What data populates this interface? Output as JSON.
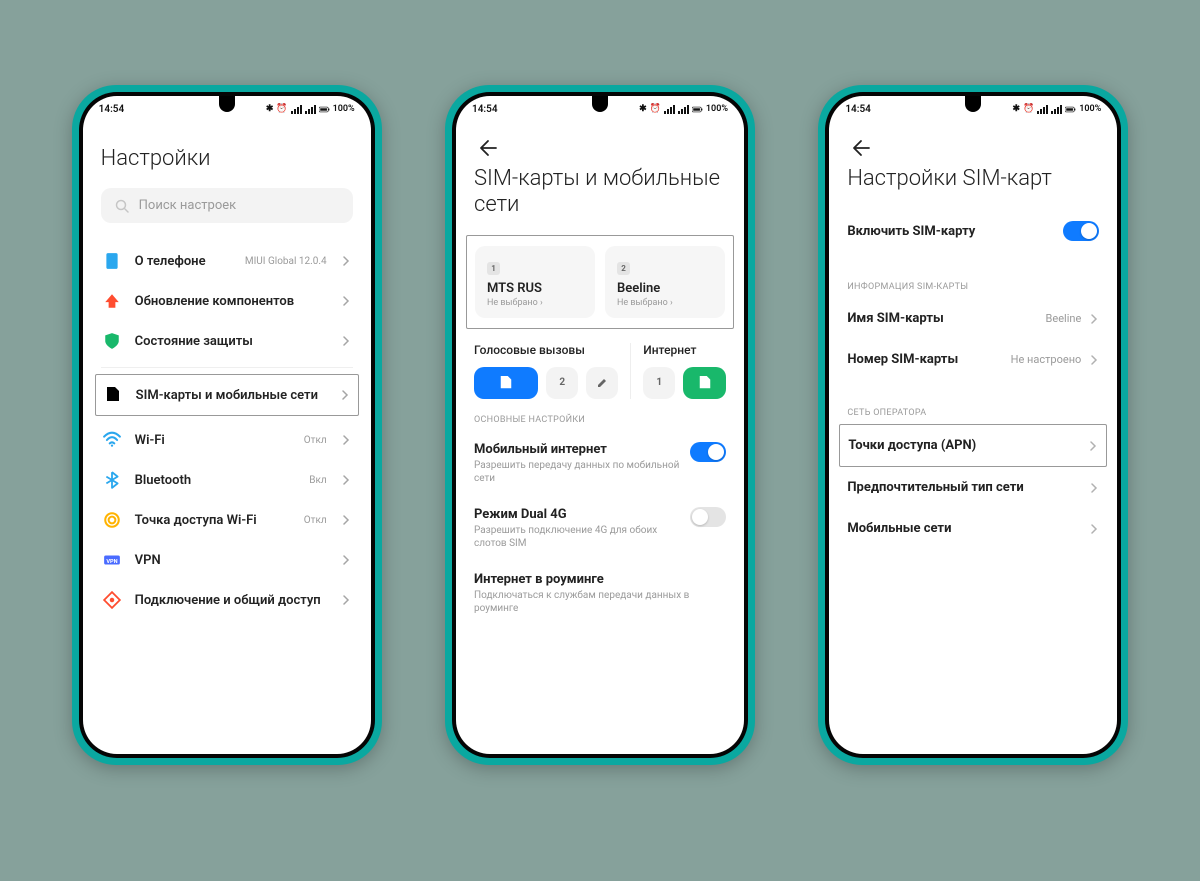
{
  "status": {
    "time": "14:54",
    "battery": "100%"
  },
  "screen1": {
    "title": "Настройки",
    "search_placeholder": "Поиск настроек",
    "items": {
      "about": {
        "label": "О телефоне",
        "value": "MIUI Global 12.0.4"
      },
      "update": {
        "label": "Обновление компонентов"
      },
      "security": {
        "label": "Состояние защиты"
      },
      "sim": {
        "label": "SIM-карты и мобильные сети"
      },
      "wifi": {
        "label": "Wi-Fi",
        "value": "Откл"
      },
      "bt": {
        "label": "Bluetooth",
        "value": "Вкл"
      },
      "hotspot": {
        "label": "Точка доступа Wi-Fi",
        "value": "Откл"
      },
      "vpn": {
        "label": "VPN"
      },
      "share": {
        "label": "Подключение и общий доступ"
      }
    }
  },
  "screen2": {
    "title": "SIM-карты и мобильные сети",
    "sim1": {
      "num": "1",
      "name": "MTS RUS",
      "sub": "Не выбрано"
    },
    "sim2": {
      "num": "2",
      "name": "Beeline",
      "sub": "Не выбрано"
    },
    "voice_label": "Голосовые вызовы",
    "internet_label": "Интернет",
    "chip1": "1",
    "chip2": "2",
    "section_main": "ОСНОВНЫЕ НАСТРОЙКИ",
    "mobile_data": {
      "title": "Мобильный интернет",
      "sub": "Разрешить передачу данных по мобильной сети"
    },
    "dual4g": {
      "title": "Режим Dual 4G",
      "sub": "Разрешить подключение 4G для обоих слотов SIM"
    },
    "roaming": {
      "title": "Интернет в роуминге",
      "sub": "Подключаться к службам передачи данных в роуминге"
    }
  },
  "screen3": {
    "title": "Настройки SIM-карт",
    "enable": "Включить SIM-карту",
    "section_info": "ИНФОРМАЦИЯ SIM-КАРТЫ",
    "sim_name": {
      "label": "Имя SIM-карты",
      "value": "Beeline"
    },
    "sim_number": {
      "label": "Номер SIM-карты",
      "value": "Не настроено"
    },
    "section_net": "СЕТЬ ОПЕРАТОРА",
    "apn": "Точки доступа (APN)",
    "net_type": "Предпочтительный тип сети",
    "mobile_nets": "Мобильные сети"
  }
}
